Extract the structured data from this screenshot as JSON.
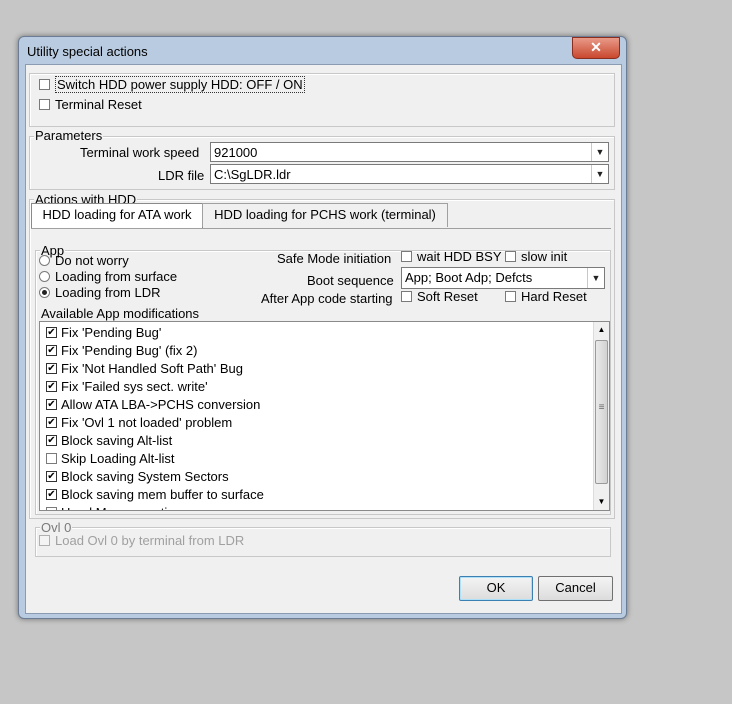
{
  "window": {
    "title": "Utility special actions",
    "close_glyph": "✕"
  },
  "top_options": [
    {
      "label": "Switch HDD power supply HDD: OFF / ON",
      "checked": false
    },
    {
      "label": "Terminal Reset",
      "checked": false
    }
  ],
  "parameters": {
    "group_label": "Parameters",
    "speed_label": "Terminal work speed",
    "speed_value": "921000",
    "ldr_label": "LDR file",
    "ldr_value": "C:\\SgLDR.ldr"
  },
  "actions": {
    "group_label": "Actions with HDD",
    "tabs": [
      {
        "label": "HDD loading for ATA work",
        "active": true
      },
      {
        "label": "HDD loading for PCHS work (terminal)",
        "active": false
      }
    ]
  },
  "app": {
    "group_label": "App",
    "radios": [
      {
        "label": "Do not worry",
        "checked": false
      },
      {
        "label": "Loading from surface",
        "checked": false
      },
      {
        "label": "Loading from LDR",
        "checked": true
      }
    ],
    "safe_mode_label": "Safe Mode initiation",
    "safe_mode_options": [
      {
        "label": "wait HDD BSY",
        "checked": false
      },
      {
        "label": "slow init",
        "checked": false
      }
    ],
    "boot_label": "Boot sequence",
    "boot_value": "App; Boot Adp; Defcts",
    "after_label": "After App code starting",
    "after_options": [
      {
        "label": "Soft Reset",
        "checked": false
      },
      {
        "label": "Hard Reset",
        "checked": false
      }
    ]
  },
  "modifications": {
    "label": "Available App modifications",
    "items": [
      {
        "label": "Fix 'Pending Bug'",
        "checked": true
      },
      {
        "label": "Fix 'Pending Bug' (fix 2)",
        "checked": true
      },
      {
        "label": "Fix 'Not Handled Soft Path' Bug",
        "checked": true
      },
      {
        "label": "Fix 'Failed sys sect. write'",
        "checked": true
      },
      {
        "label": "Allow ATA LBA->PCHS conversion",
        "checked": true
      },
      {
        "label": "Fix 'Ovl 1 not loaded' problem",
        "checked": true
      },
      {
        "label": "Block saving Alt-list",
        "checked": true
      },
      {
        "label": "Skip Loading Alt-list",
        "checked": false
      },
      {
        "label": "Block saving System Sectors",
        "checked": true
      },
      {
        "label": "Block saving mem buffer to surface",
        "checked": true
      },
      {
        "label": "Head Map correction",
        "checked": false
      }
    ]
  },
  "ovl0": {
    "group_label": "Ovl 0",
    "option_label": "Load Ovl 0 by terminal from LDR",
    "checked": false
  },
  "buttons": {
    "ok": "OK",
    "cancel": "Cancel"
  },
  "icons": {
    "combo_arrow": "▼",
    "scroll_up": "▲",
    "scroll_down": "▼",
    "scroll_grip": "≡",
    "check": "✔"
  }
}
